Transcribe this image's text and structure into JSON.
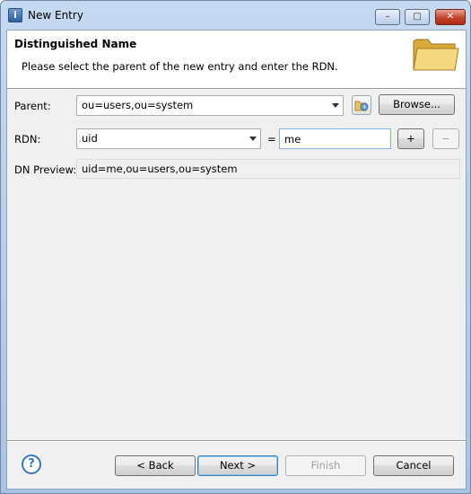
{
  "window": {
    "title": "New Entry",
    "minimize_glyph": "–",
    "maximize_glyph": "□",
    "close_glyph": "✕"
  },
  "header": {
    "title": "Distinguished Name",
    "description": "Please select the parent of the new entry and enter the RDN."
  },
  "form": {
    "parent_label": "Parent:",
    "parent_value": "ou=users,ou=system",
    "browse_label": "Browse...",
    "rdn_label": "RDN:",
    "rdn_attribute": "uid",
    "equals": "=",
    "rdn_value": "me",
    "add_label": "+",
    "remove_label": "−",
    "preview_label": "DN Preview:",
    "preview_value": "uid=me,ou=users,ou=system"
  },
  "footer": {
    "help_glyph": "?",
    "back_label": "< Back",
    "next_label": "Next >",
    "finish_label": "Finish",
    "cancel_label": "Cancel"
  },
  "colors": {
    "accent": "#3a76bb",
    "folder": "#e8c35a"
  },
  "icons": [
    "app-icon",
    "folder-icon",
    "parent-history-icon",
    "help-icon"
  ]
}
